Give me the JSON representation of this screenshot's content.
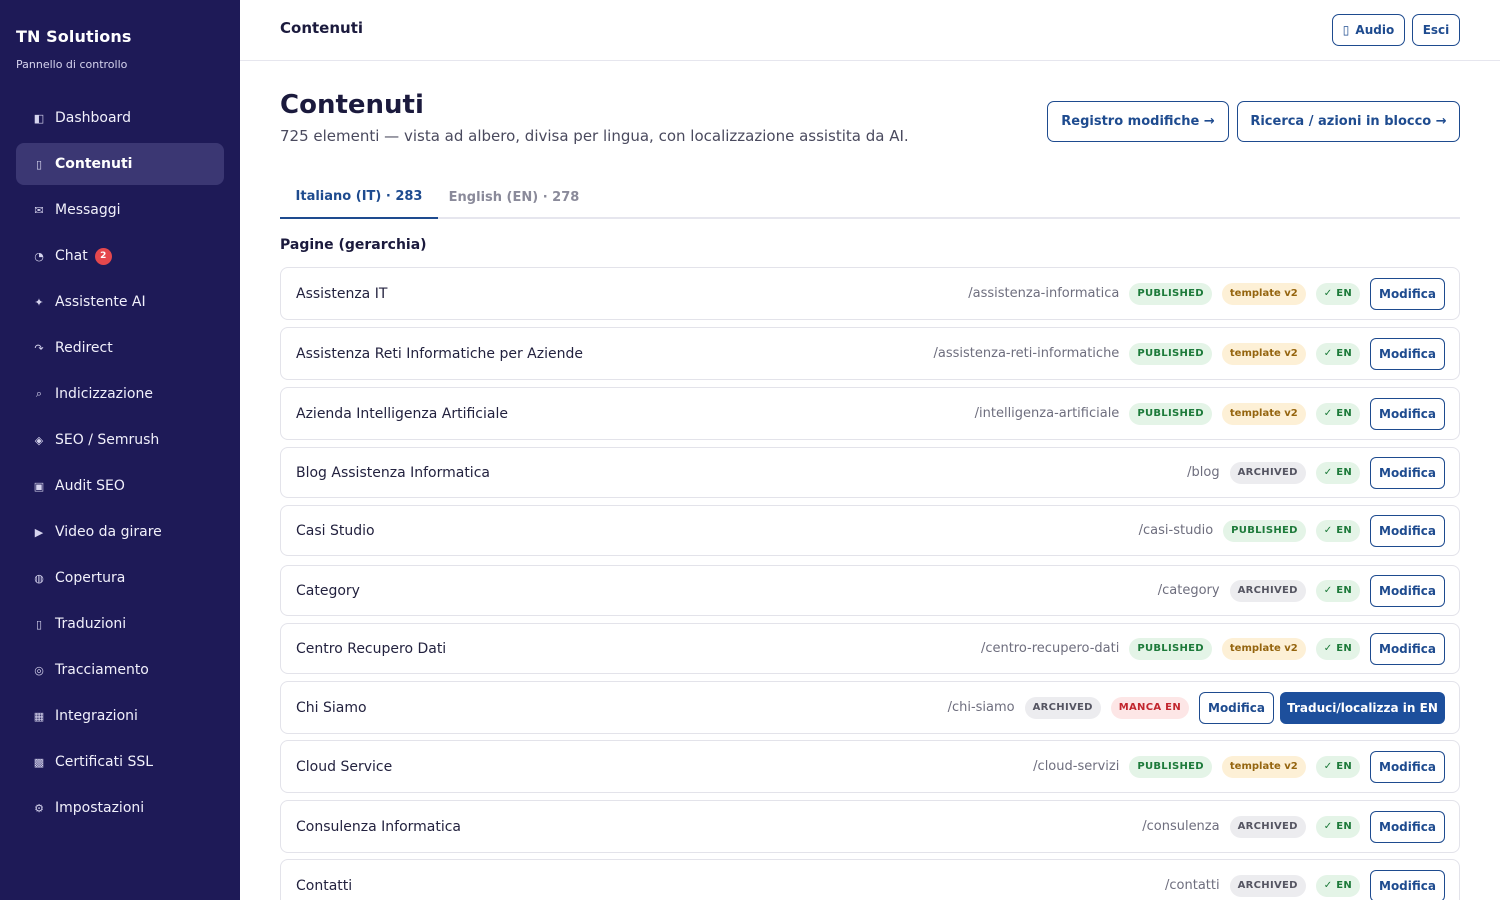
{
  "sidebar": {
    "brand": "TN Solutions",
    "subtitle": "Pannello di controllo",
    "items": [
      {
        "label": "Dashboard",
        "icon": "dashboard-icon",
        "glyph": "◧"
      },
      {
        "label": "Contenuti",
        "icon": "content-icon",
        "glyph": "▯"
      },
      {
        "label": "Messaggi",
        "icon": "mail-icon",
        "glyph": "✉"
      },
      {
        "label": "Chat",
        "icon": "chat-icon",
        "glyph": "◔",
        "badge": "2"
      },
      {
        "label": "Assistente AI",
        "icon": "sparkle-icon",
        "glyph": "✦"
      },
      {
        "label": "Redirect",
        "icon": "redirect-icon",
        "glyph": "↷"
      },
      {
        "label": "Indicizzazione",
        "icon": "search-icon",
        "glyph": "⌕"
      },
      {
        "label": "SEO / Semrush",
        "icon": "seo-icon",
        "glyph": "◈"
      },
      {
        "label": "Audit SEO",
        "icon": "audit-icon",
        "glyph": "▣"
      },
      {
        "label": "Video da girare",
        "icon": "play-icon",
        "glyph": "▶"
      },
      {
        "label": "Copertura",
        "icon": "globe-icon",
        "glyph": "◍"
      },
      {
        "label": "Traduzioni",
        "icon": "translate-icon",
        "glyph": "▯"
      },
      {
        "label": "Tracciamento",
        "icon": "target-icon",
        "glyph": "◎"
      },
      {
        "label": "Integrazioni",
        "icon": "grid-icon",
        "glyph": "▦"
      },
      {
        "label": "Certificati SSL",
        "icon": "certificate-icon",
        "glyph": "▩"
      },
      {
        "label": "Impostazioni",
        "icon": "gear-icon",
        "glyph": "⚙"
      }
    ],
    "active_index": 1
  },
  "header": {
    "title": "Contenuti",
    "audio_label": "Audio",
    "audio_icon": "▯",
    "exit_label": "Esci"
  },
  "main": {
    "title": "Contenuti",
    "subtitle": "725 elementi — vista ad albero, divisa per lingua, con localizzazione assistita da AI.",
    "registro_label": "Registro modifiche →",
    "ricerca_label": "Ricerca / azioni in blocco →",
    "tabs": [
      {
        "label": "Italiano (IT) · 283",
        "active": true
      },
      {
        "label": "English (EN) · 278",
        "active": false
      }
    ],
    "section_title": "Pagine (gerarchia)",
    "edit_label": "Modifica",
    "translate_label": "Traduci/localizza in EN",
    "rows": [
      {
        "title": "Assistenza IT",
        "slug": "/assistenza-informatica",
        "status": "PUBLISHED",
        "template": "template v2",
        "lang": "✓ EN"
      },
      {
        "title": "Assistenza Reti Informatiche per Aziende",
        "slug": "/assistenza-reti-informatiche",
        "status": "PUBLISHED",
        "template": "template v2",
        "lang": "✓ EN"
      },
      {
        "title": "Azienda Intelligenza Artificiale",
        "slug": "/intelligenza-artificiale",
        "status": "PUBLISHED",
        "template": "template v2",
        "lang": "✓ EN"
      },
      {
        "title": "Blog Assistenza Informatica",
        "slug": "/blog",
        "status": "ARCHIVED",
        "template": null,
        "lang": "✓ EN"
      },
      {
        "title": "Casi Studio",
        "slug": "/casi-studio",
        "status": "PUBLISHED",
        "template": null,
        "lang": "✓ EN"
      },
      {
        "title": "Category",
        "slug": "/category",
        "status": "ARCHIVED",
        "template": null,
        "lang": "✓ EN"
      },
      {
        "title": "Centro Recupero Dati",
        "slug": "/centro-recupero-dati",
        "status": "PUBLISHED",
        "template": "template v2",
        "lang": "✓ EN"
      },
      {
        "title": "Chi Siamo",
        "slug": "/chi-siamo",
        "status": "ARCHIVED",
        "template": null,
        "missing": "MANCA EN",
        "translate": true
      },
      {
        "title": "Cloud Service",
        "slug": "/cloud-servizi",
        "status": "PUBLISHED",
        "template": "template v2",
        "lang": "✓ EN"
      },
      {
        "title": "Consulenza Informatica",
        "slug": "/consulenza",
        "status": "ARCHIVED",
        "template": null,
        "lang": "✓ EN"
      },
      {
        "title": "Contatti",
        "slug": "/contatti",
        "status": "ARCHIVED",
        "template": null,
        "lang": "✓ EN"
      }
    ]
  },
  "colors": {
    "sidebar_bg": "#1e1a57",
    "accent": "#1e4b8f",
    "published": "#1d7a3a",
    "missing": "#c2262e"
  }
}
